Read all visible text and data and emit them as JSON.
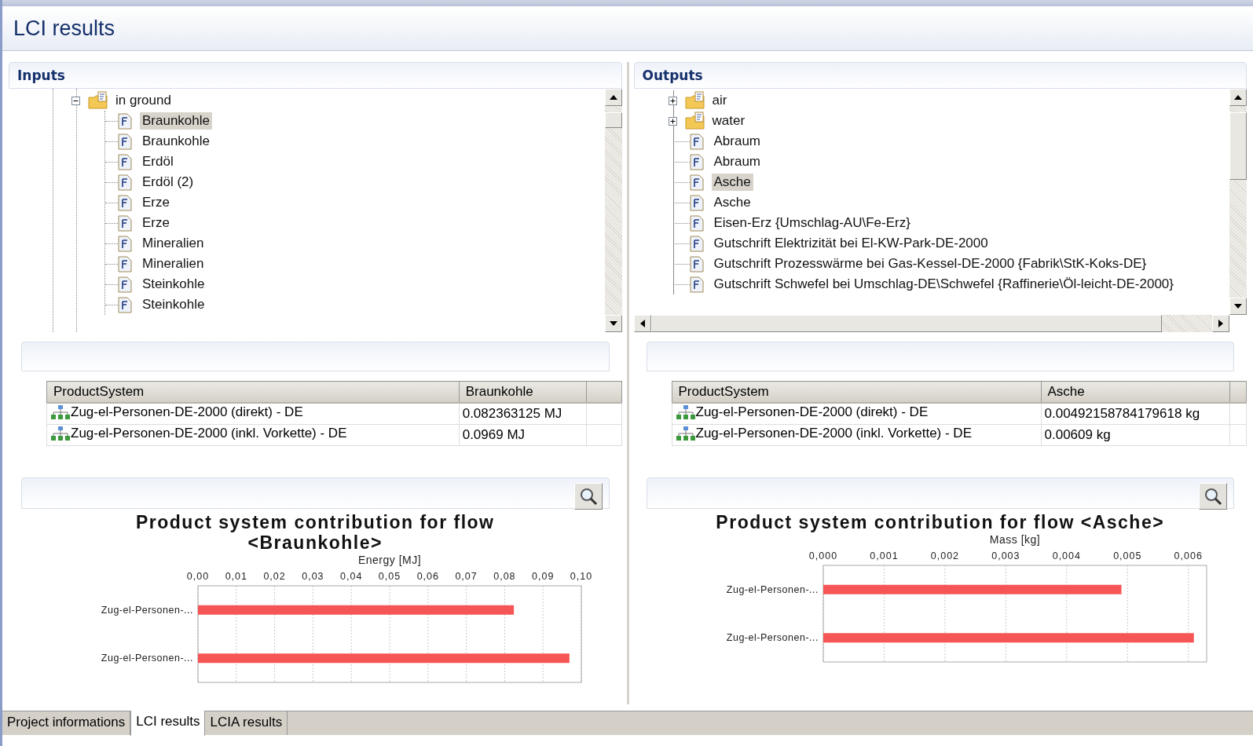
{
  "header": {
    "title": "LCI results"
  },
  "inputs": {
    "title": "Inputs",
    "tree": [
      {
        "label": "in ground",
        "kind": "folder",
        "expanded": true,
        "selected": false,
        "children": [
          {
            "label": "Braunkohle",
            "kind": "flow",
            "selected": true
          },
          {
            "label": "Braunkohle",
            "kind": "flow",
            "selected": false
          },
          {
            "label": "Erdöl",
            "kind": "flow",
            "selected": false
          },
          {
            "label": "Erdöl (2)",
            "kind": "flow",
            "selected": false
          },
          {
            "label": "Erze",
            "kind": "flow",
            "selected": false
          },
          {
            "label": "Erze",
            "kind": "flow",
            "selected": false
          },
          {
            "label": "Mineralien",
            "kind": "flow",
            "selected": false
          },
          {
            "label": "Mineralien",
            "kind": "flow",
            "selected": false
          },
          {
            "label": "Steinkohle",
            "kind": "flow",
            "selected": false
          },
          {
            "label": "Steinkohle",
            "kind": "flow",
            "selected": false
          }
        ]
      }
    ],
    "table": {
      "columns": [
        "ProductSystem",
        "Braunkohle"
      ],
      "rows": [
        [
          "Zug-el-Personen-DE-2000 (direkt) - DE",
          "0.082363125 MJ"
        ],
        [
          "Zug-el-Personen-DE-2000 (inkl. Vorkette) - DE",
          "0.0969 MJ"
        ]
      ]
    },
    "chart_data": {
      "type": "bar",
      "orientation": "horizontal",
      "title": "Product system contribution for flow <Braunkohle>",
      "xlabel": "Energy [MJ]",
      "categories": [
        "Zug-el-Personen-...",
        "Zug-el-Personen-..."
      ],
      "values": [
        0.0824,
        0.0969
      ],
      "xlim": [
        0,
        0.1
      ],
      "grid": true,
      "xticks": [
        {
          "value": 0,
          "label": "0,00"
        },
        {
          "value": 0.01,
          "label": "0,01"
        },
        {
          "value": 0.02,
          "label": "0,02"
        },
        {
          "value": 0.03,
          "label": "0,03"
        },
        {
          "value": 0.04,
          "label": "0,04"
        },
        {
          "value": 0.05,
          "label": "0,05"
        },
        {
          "value": 0.06,
          "label": "0,06"
        },
        {
          "value": 0.07,
          "label": "0,07"
        },
        {
          "value": 0.08,
          "label": "0,08"
        },
        {
          "value": 0.09,
          "label": "0,09"
        },
        {
          "value": 0.1,
          "label": "0,10"
        }
      ]
    }
  },
  "outputs": {
    "title": "Outputs",
    "tree": [
      {
        "label": "air",
        "kind": "folder",
        "expanded": false,
        "selected": false
      },
      {
        "label": "water",
        "kind": "folder",
        "expanded": false,
        "selected": false
      },
      {
        "label": "Abraum",
        "kind": "flow",
        "selected": false
      },
      {
        "label": "Abraum",
        "kind": "flow",
        "selected": false
      },
      {
        "label": "Asche",
        "kind": "flow",
        "selected": true
      },
      {
        "label": "Asche",
        "kind": "flow",
        "selected": false
      },
      {
        "label": "Eisen-Erz {Umschlag-AU\\Fe-Erz}",
        "kind": "flow",
        "selected": false
      },
      {
        "label": "Gutschrift Elektrizität bei El-KW-Park-DE-2000",
        "kind": "flow",
        "selected": false
      },
      {
        "label": "Gutschrift Prozesswärme bei Gas-Kessel-DE-2000 {Fabrik\\StK-Koks-DE}",
        "kind": "flow",
        "selected": false
      },
      {
        "label": "Gutschrift Schwefel bei Umschlag-DE\\Schwefel {Raffinerie\\Öl-leicht-DE-2000}",
        "kind": "flow",
        "selected": false
      }
    ],
    "table": {
      "columns": [
        "ProductSystem",
        "Asche"
      ],
      "rows": [
        [
          "Zug-el-Personen-DE-2000 (direkt) - DE",
          "0.00492158784179618 kg"
        ],
        [
          "Zug-el-Personen-DE-2000 (inkl. Vorkette) - DE",
          "0.00609 kg"
        ]
      ]
    },
    "chart_data": {
      "type": "bar",
      "orientation": "horizontal",
      "title": "Product system contribution for flow <Asche>",
      "xlabel": "Mass [kg]",
      "categories": [
        "Zug-el-Personen-...",
        "Zug-el-Personen-..."
      ],
      "values": [
        0.0049,
        0.00609
      ],
      "xlim": [
        0,
        0.0063
      ],
      "grid": true,
      "xticks": [
        {
          "value": 0,
          "label": "0,000"
        },
        {
          "value": 0.001,
          "label": "0,001"
        },
        {
          "value": 0.002,
          "label": "0,002"
        },
        {
          "value": 0.003,
          "label": "0,003"
        },
        {
          "value": 0.004,
          "label": "0,004"
        },
        {
          "value": 0.005,
          "label": "0,005"
        },
        {
          "value": 0.006,
          "label": "0,006"
        }
      ]
    }
  },
  "tabs": [
    {
      "label": "Project informations",
      "selected": false
    },
    {
      "label": "LCI results",
      "selected": true
    },
    {
      "label": "LCIA results",
      "selected": false
    }
  ]
}
